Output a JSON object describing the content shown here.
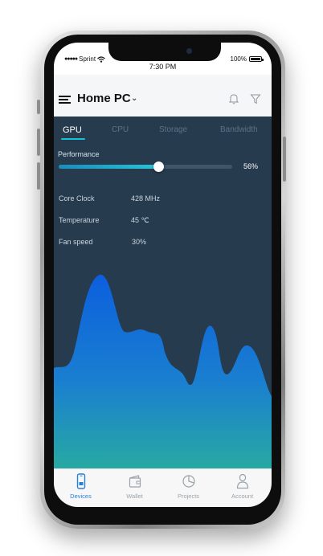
{
  "status_bar": {
    "carrier": "Sprint",
    "time": "7:30 PM",
    "battery": "100%"
  },
  "header": {
    "title": "Home PC"
  },
  "tabs": [
    {
      "label": "GPU",
      "active": true
    },
    {
      "label": "CPU",
      "active": false
    },
    {
      "label": "Storage",
      "active": false
    },
    {
      "label": "Bandwidth",
      "active": false
    }
  ],
  "performance": {
    "label": "Performance",
    "value_text": "56%",
    "level": 0.56
  },
  "stats": [
    {
      "label": "Core Clock",
      "value": "428 MHz"
    },
    {
      "label": "Temperature",
      "value": "45 ℃"
    },
    {
      "label": "Fan speed",
      "value": "30%"
    }
  ],
  "tabbar": [
    {
      "label": "Devices",
      "icon": "phone-icon",
      "active": true
    },
    {
      "label": "Wallet",
      "icon": "wallet-icon",
      "active": false
    },
    {
      "label": "Projects",
      "icon": "pie-chart-icon",
      "active": false
    },
    {
      "label": "Account",
      "icon": "person-icon",
      "active": false
    }
  ],
  "colors": {
    "accent": "#16c0d6",
    "screen_bg": "#263b4e",
    "chart_top": "#0c5fdd",
    "chart_bottom": "#27a9a3",
    "active_tab": "#2a7fd6"
  }
}
